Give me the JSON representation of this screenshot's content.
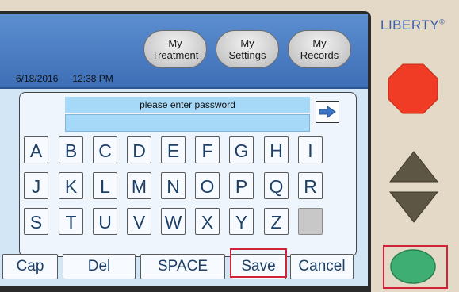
{
  "header": {
    "nav": [
      {
        "label": "My\nTreatment"
      },
      {
        "label": "My\nSettings"
      },
      {
        "label": "My\nRecords"
      }
    ],
    "date": "6/18/2016",
    "time": "12:38 PM"
  },
  "keyboard": {
    "prompt": "please enter password",
    "password_value": "",
    "rows": [
      [
        "A",
        "B",
        "C",
        "D",
        "E",
        "F",
        "G",
        "H",
        "I"
      ],
      [
        "J",
        "K",
        "L",
        "M",
        "N",
        "O",
        "P",
        "Q",
        "R"
      ],
      [
        "S",
        "T",
        "U",
        "V",
        "W",
        "X",
        "Y",
        "Z",
        ""
      ]
    ],
    "enter_icon": "right-arrow-icon"
  },
  "actions": {
    "cap": "Cap",
    "del": "Del",
    "space": "SPACE",
    "save": "Save",
    "cancel": "Cancel"
  },
  "device": {
    "brand": "LIBERTY",
    "brand_mark": "®",
    "buttons": {
      "stop": {
        "icon": "stop-octagon-icon",
        "color": "#f03b25"
      },
      "up": {
        "icon": "up-triangle-icon",
        "color": "#5e5645"
      },
      "down": {
        "icon": "down-triangle-icon",
        "color": "#5e5645"
      },
      "go": {
        "icon": "green-oval-icon",
        "color": "#3fae73"
      }
    }
  },
  "colors": {
    "header_blue": "#4a7cc4",
    "highlight_red": "#d0233a",
    "key_text": "#1e3f66"
  }
}
